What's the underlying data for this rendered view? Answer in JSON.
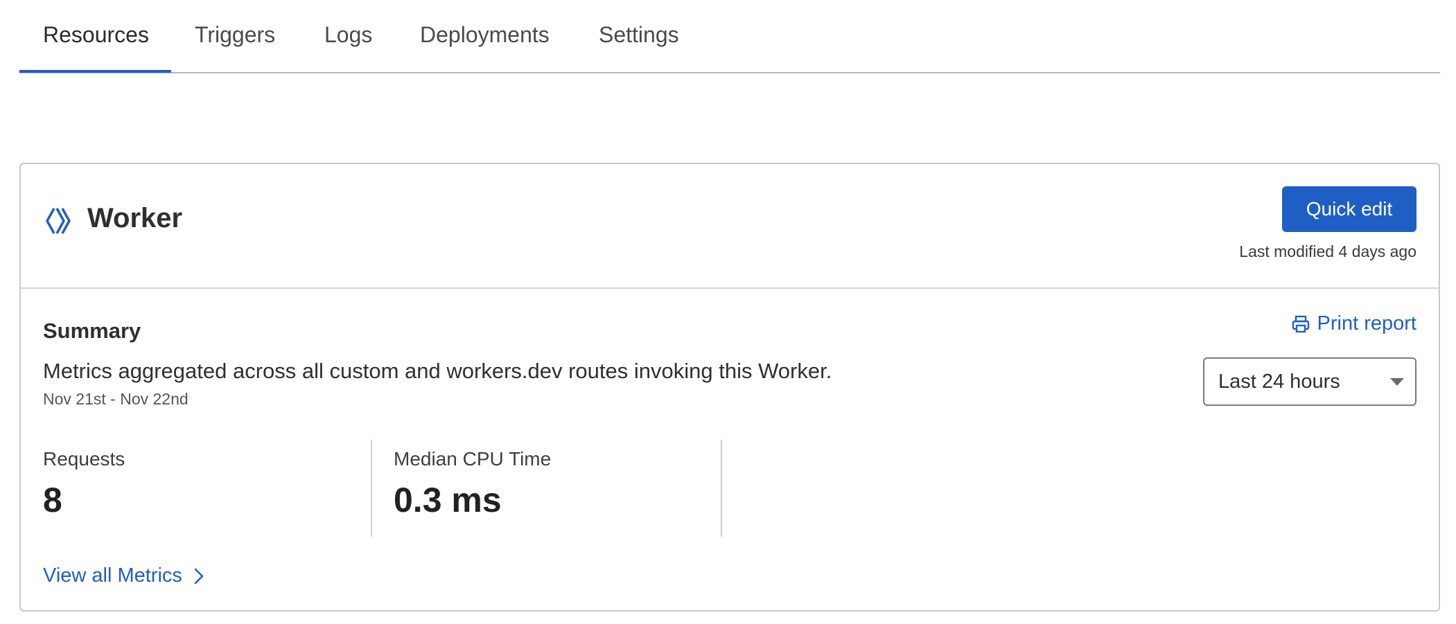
{
  "tabs": [
    {
      "label": "Resources",
      "active": true
    },
    {
      "label": "Triggers",
      "active": false
    },
    {
      "label": "Logs",
      "active": false
    },
    {
      "label": "Deployments",
      "active": false
    },
    {
      "label": "Settings",
      "active": false
    }
  ],
  "card": {
    "title": "Worker",
    "quick_edit_label": "Quick edit",
    "last_modified": "Last modified 4 days ago"
  },
  "summary": {
    "title": "Summary",
    "description": "Metrics aggregated across all custom and workers.dev routes invoking this Worker.",
    "date_range": "Nov 21st - Nov 22nd",
    "print_report_label": "Print report",
    "time_range_select": "Last 24 hours"
  },
  "metrics": [
    {
      "label": "Requests",
      "value": "8"
    },
    {
      "label": "Median CPU Time",
      "value": "0.3 ms"
    }
  ],
  "view_all_metrics_label": "View all Metrics",
  "colors": {
    "accent": "#1f5ec5",
    "text": "#2f2f2f",
    "border": "#c9c9c9"
  },
  "icons": {
    "worker": "worker-icon",
    "print": "printer-icon",
    "dropdown": "caret-down-icon",
    "view_all": "chevron-right-icon"
  }
}
